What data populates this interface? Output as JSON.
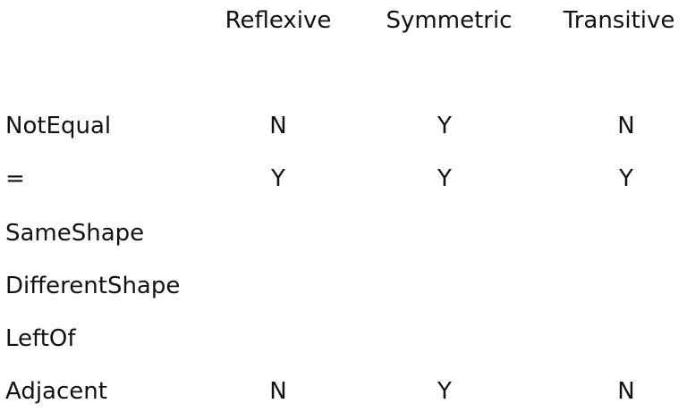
{
  "table": {
    "columns": [
      "Reflexive",
      "Symmetric",
      "Transitive"
    ],
    "rows": [
      {
        "label": "NotEqual",
        "values": [
          "N",
          "Y",
          "N"
        ]
      },
      {
        "label": "=",
        "values": [
          "Y",
          "Y",
          "Y"
        ]
      },
      {
        "label": "SameShape",
        "values": [
          "",
          "",
          ""
        ]
      },
      {
        "label": "DifferentShape",
        "values": [
          "",
          "",
          ""
        ]
      },
      {
        "label": "LeftOf",
        "values": [
          "",
          "",
          ""
        ]
      },
      {
        "label": "Adjacent",
        "values": [
          "N",
          "Y",
          "N"
        ]
      }
    ]
  }
}
